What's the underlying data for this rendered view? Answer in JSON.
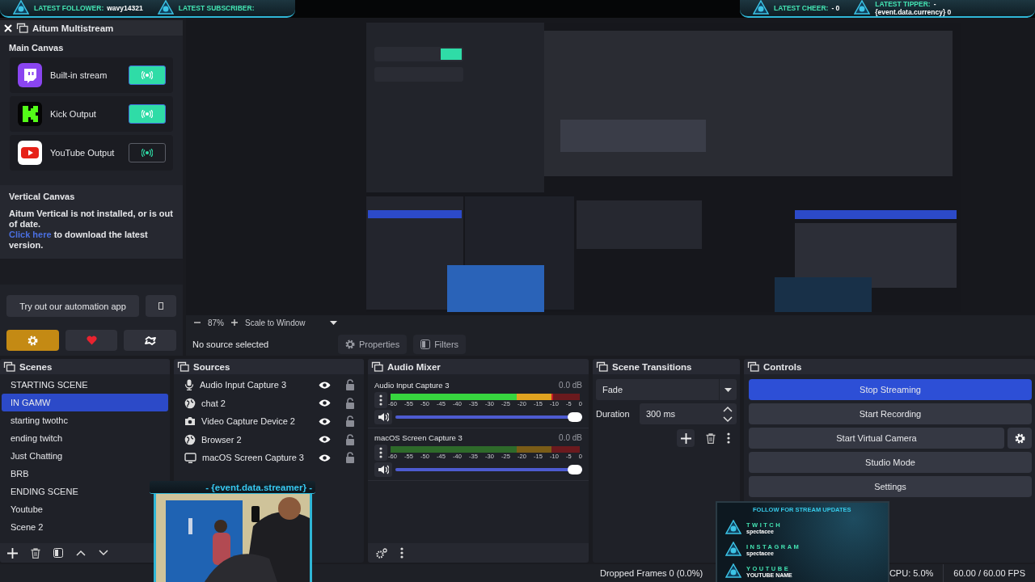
{
  "top_banner": {
    "left": [
      {
        "label": "LATEST FOLLOWER:",
        "value": "wavy14321"
      },
      {
        "label": "LATEST SUBSCRIBER:"
      }
    ],
    "right": [
      {
        "label": "LATEST CHEER:",
        "value": "- 0"
      },
      {
        "label": "LATEST TIPPER:",
        "value": "-",
        "detail": "{event.data.currency} 0"
      }
    ]
  },
  "aitum": {
    "title": "Aitum Multistream",
    "main_canvas": {
      "heading": "Main Canvas",
      "outputs": [
        {
          "kind": "twitch",
          "name": "Built-in stream",
          "on": true
        },
        {
          "kind": "kick",
          "name": "Kick Output",
          "on": true
        },
        {
          "kind": "youtube",
          "name": "YouTube Output",
          "on": false
        }
      ]
    },
    "vertical_canvas": {
      "heading": "Vertical Canvas",
      "message": "Aitum Vertical is not installed, or is out of date.",
      "link": "Click here",
      "link_suffix": " to download the latest version."
    },
    "automation_button": "Try out our automation app",
    "footer_buttons": [
      {
        "kind": "settings",
        "highlighted": true
      },
      {
        "kind": "heart",
        "highlighted": false
      },
      {
        "kind": "exchange",
        "highlighted": false
      }
    ]
  },
  "preview": {
    "zoom": "87%",
    "scale_mode": "Scale to Window"
  },
  "source_toolbar": {
    "status": "No source selected",
    "buttons": [
      {
        "kind": "properties",
        "label": "Properties"
      },
      {
        "kind": "filters",
        "label": "Filters"
      }
    ]
  },
  "scenes": {
    "title": "Scenes",
    "items": [
      {
        "name": "STARTING SCENE",
        "selected": false
      },
      {
        "name": "IN GAMW",
        "selected": true
      },
      {
        "name": "starting twothc",
        "selected": false
      },
      {
        "name": "ending twitch",
        "selected": false
      },
      {
        "name": "Just Chatting",
        "selected": false
      },
      {
        "name": "BRB",
        "selected": false
      },
      {
        "name": "ENDING SCENE",
        "selected": false
      },
      {
        "name": "Youtube",
        "selected": false
      },
      {
        "name": "Scene 2",
        "selected": false
      }
    ]
  },
  "sources": {
    "title": "Sources",
    "items": [
      {
        "name": "Audio Input Capture 3",
        "kind": "audio",
        "visible": true,
        "locked": false
      },
      {
        "name": "chat 2",
        "kind": "browser",
        "visible": true,
        "locked": false
      },
      {
        "name": "Video Capture Device 2",
        "kind": "camera",
        "visible": true,
        "locked": false
      },
      {
        "name": "Browser 2",
        "kind": "browser",
        "visible": true,
        "locked": false
      },
      {
        "name": "macOS Screen Capture 3",
        "kind": "display",
        "visible": true,
        "locked": false
      }
    ]
  },
  "audio_mixer": {
    "title": "Audio Mixer",
    "channels": [
      {
        "name": "Audio Input Capture 3",
        "reading": "0.0 dB",
        "meter": {
          "level": 0.86
        },
        "volume": {
          "level": 1
        },
        "scale": [
          "-60",
          "-55",
          "-50",
          "-45",
          "-40",
          "-35",
          "-30",
          "-25",
          "-20",
          "-15",
          "-10",
          "-5",
          "0"
        ]
      },
      {
        "name": "macOS Screen Capture 3",
        "reading": "0.0 dB",
        "meter": {
          "level": 0
        },
        "volume": {
          "level": 1
        },
        "scale": [
          "-60",
          "-55",
          "-50",
          "-45",
          "-40",
          "-35",
          "-30",
          "-25",
          "-20",
          "-15",
          "-10",
          "-5",
          "0"
        ]
      }
    ]
  },
  "scene_transitions": {
    "title": "Scene Transitions",
    "transition": "Fade",
    "duration_label": "Duration",
    "duration": "300 ms"
  },
  "controls": {
    "title": "Controls",
    "buttons": [
      {
        "label": "Stop Streaming",
        "active": true,
        "has_settings": false
      },
      {
        "label": "Start Recording",
        "active": false,
        "has_settings": false
      },
      {
        "label": "Start Virtual Camera",
        "active": false,
        "has_settings": true
      },
      {
        "label": "Studio Mode",
        "active": false,
        "has_settings": false
      },
      {
        "label": "Settings",
        "active": false,
        "has_settings": false
      }
    ]
  },
  "status_bar": {
    "dropped_frames": "Dropped Frames 0 (0.0%)",
    "cpu": "CPU: 5.0%",
    "fps": "60.00 / 60.00 FPS"
  },
  "webcam_overlay": {
    "caption": "- {event.data.streamer} -"
  },
  "social_overlay": {
    "heading": "FOLLOW FOR STREAM UPDATES",
    "accounts": [
      {
        "platform": "TWITCH",
        "handle": "spectacee"
      },
      {
        "platform": "INSTAGRAM",
        "handle": "spectacee"
      },
      {
        "platform": "YOUTUBE",
        "handle": "YOUTUBE NAME"
      }
    ]
  }
}
